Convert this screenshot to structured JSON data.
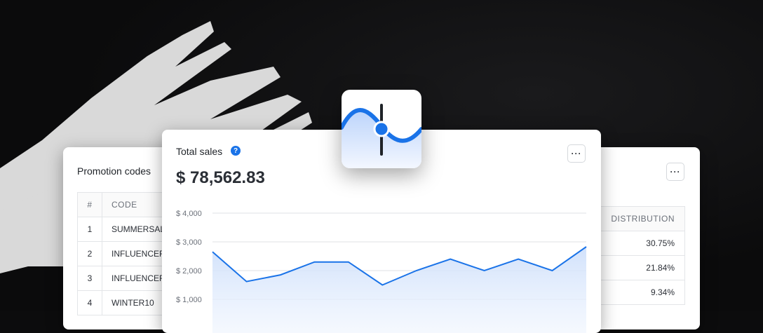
{
  "promo_card": {
    "title": "Promotion codes",
    "headers": [
      "#",
      "CODE"
    ],
    "rows": [
      {
        "num": "1",
        "code": "SUMMERSALE"
      },
      {
        "num": "2",
        "code": "INFLUENCER"
      },
      {
        "num": "3",
        "code": "INFLUENCER"
      },
      {
        "num": "4",
        "code": "WINTER10"
      }
    ]
  },
  "sales_card": {
    "title": "Total sales",
    "help_icon": "?",
    "more_label": "···",
    "total": "$ 78,562.83"
  },
  "dist_card": {
    "more_label": "···",
    "header": "DISTRIBUTION",
    "values": [
      "30.75%",
      "21.84%",
      "9.34%"
    ]
  },
  "chart_data": {
    "type": "area",
    "y_ticks": [
      "$ 4,000",
      "$ 3,000",
      "$ 2,000",
      "$ 1,000"
    ],
    "ylim": [
      0,
      4000
    ],
    "values": [
      2650,
      1620,
      1850,
      2300,
      2300,
      1500,
      2000,
      2400,
      2000,
      2400,
      2000,
      2830
    ],
    "line_color": "#1a73e8",
    "fill_color": "#cfe0fb"
  },
  "colors": {
    "accent": "#1a73e8"
  }
}
